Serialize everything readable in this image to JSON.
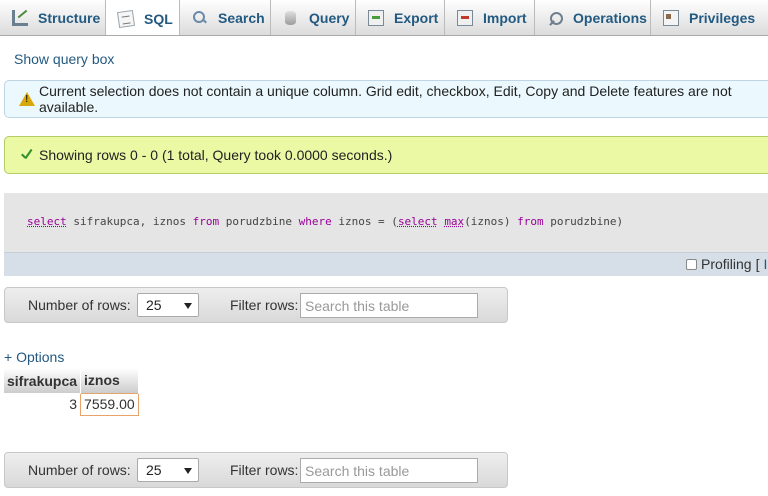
{
  "tabs": [
    {
      "label": "Structure",
      "icon": "structure-icon"
    },
    {
      "label": "SQL",
      "icon": "sql-icon",
      "active": true
    },
    {
      "label": "Search",
      "icon": "search-icon"
    },
    {
      "label": "Query",
      "icon": "query-icon"
    },
    {
      "label": "Export",
      "icon": "export-icon"
    },
    {
      "label": "Import",
      "icon": "import-icon"
    },
    {
      "label": "Operations",
      "icon": "operations-icon"
    },
    {
      "label": "Privileges",
      "icon": "privileges-icon"
    }
  ],
  "show_query_box": "Show query box",
  "warning": {
    "text": "Current selection does not contain a unique column. Grid edit, checkbox, Edit, Copy and Delete features are not available.",
    "icon": "warning-icon"
  },
  "success": {
    "text": "Showing rows 0 - 0 (1 total, Query took 0.0000 seconds.)",
    "icon": "check-icon"
  },
  "sql": {
    "parts": [
      {
        "text": "select",
        "kind": "kw-u"
      },
      {
        "text": " sifrakupca, iznos ",
        "kind": "plain"
      },
      {
        "text": "from",
        "kind": "kw"
      },
      {
        "text": " porudzbine ",
        "kind": "plain"
      },
      {
        "text": "where",
        "kind": "kw"
      },
      {
        "text": " iznos = (",
        "kind": "plain"
      },
      {
        "text": "select",
        "kind": "kw-u"
      },
      {
        "text": " ",
        "kind": "plain"
      },
      {
        "text": "max",
        "kind": "fn"
      },
      {
        "text": "(iznos) ",
        "kind": "plain"
      },
      {
        "text": "from",
        "kind": "kw"
      },
      {
        "text": " porudzbine)",
        "kind": "plain"
      }
    ]
  },
  "profiling": {
    "label": "Profiling",
    "bracket": "[",
    "link": "In"
  },
  "navbar": {
    "rows_label": "Number of rows:",
    "rows_value": "25",
    "filter_label": "Filter rows:",
    "filter_placeholder": "Search this table"
  },
  "options_link": "+ Options",
  "table": {
    "columns": [
      "sifrakupca",
      "iznos"
    ],
    "rows": [
      [
        "3",
        "7559.00"
      ]
    ]
  },
  "colors": {
    "link": "#235a81",
    "warning_bg": "#ebf8fd",
    "success_bg": "#ebf8a4"
  }
}
